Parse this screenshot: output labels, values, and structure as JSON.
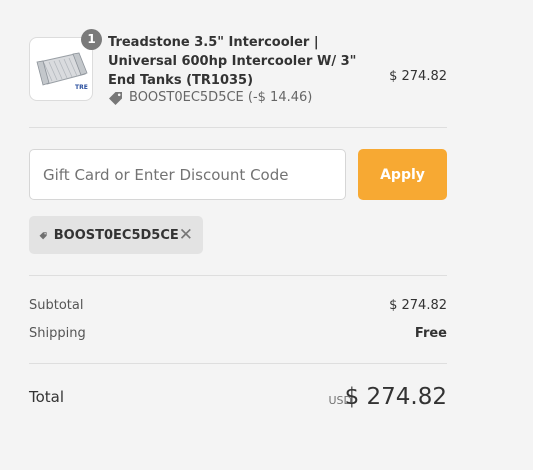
{
  "product": {
    "quantity": "1",
    "name": "Treadstone 3.5\" Intercooler | Universal 600hp Intercooler W/ 3\" End Tanks (TR1035)",
    "discount": "BOOST0EC5D5CE (-$ 14.46)",
    "price": "$ 274.82",
    "thumbnail_icon": "intercooler-image",
    "thumbnail_brand": "TRE"
  },
  "discount_form": {
    "placeholder": "Gift Card or Enter Discount Code",
    "value": "",
    "apply_label": "Apply",
    "accent_color": "#f7a933"
  },
  "applied_code": {
    "code": "BOOST0EC5D5CE",
    "remove_icon": "close-icon"
  },
  "summary": {
    "subtotal_label": "Subtotal",
    "subtotal_value": "$ 274.82",
    "shipping_label": "Shipping",
    "shipping_value": "Free"
  },
  "total": {
    "label": "Total",
    "currency": "USD",
    "amount": "$ 274.82"
  }
}
